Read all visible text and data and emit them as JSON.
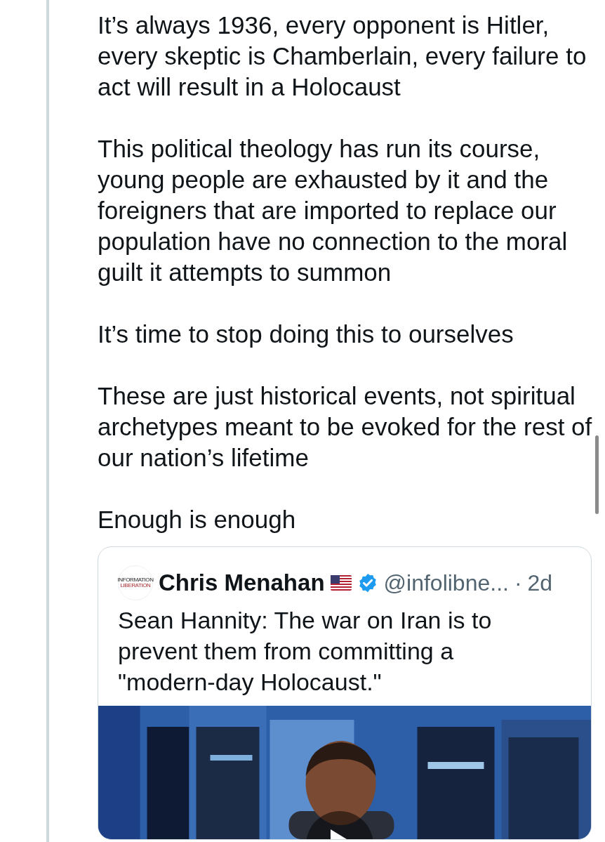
{
  "thread_post": {
    "paragraphs": [
      "It’s always 1936, every opponent is Hitler, every skeptic is Chamberlain, every failure to act will result in a Holocaust",
      "This political theology has run its course, young people are exhausted by it and the foreigners that are imported to replace our population have no connection to the moral guilt it attempts to summon",
      "It’s time to stop doing this to ourselves",
      "These are just historical events, not spiritual archetypes meant to be evoked for the rest of our nation’s lifetime",
      "Enough is enough"
    ]
  },
  "quoted_post": {
    "avatar_text": [
      "INFORMATION",
      "LIBERATION"
    ],
    "author": "Chris Menahan",
    "verified": true,
    "handle": "@infolibne...",
    "separator": "·",
    "time": "2d",
    "text": "Sean Hannity: The war on Iran is to prevent them from committing a \"modern-day Holocaust.\""
  }
}
